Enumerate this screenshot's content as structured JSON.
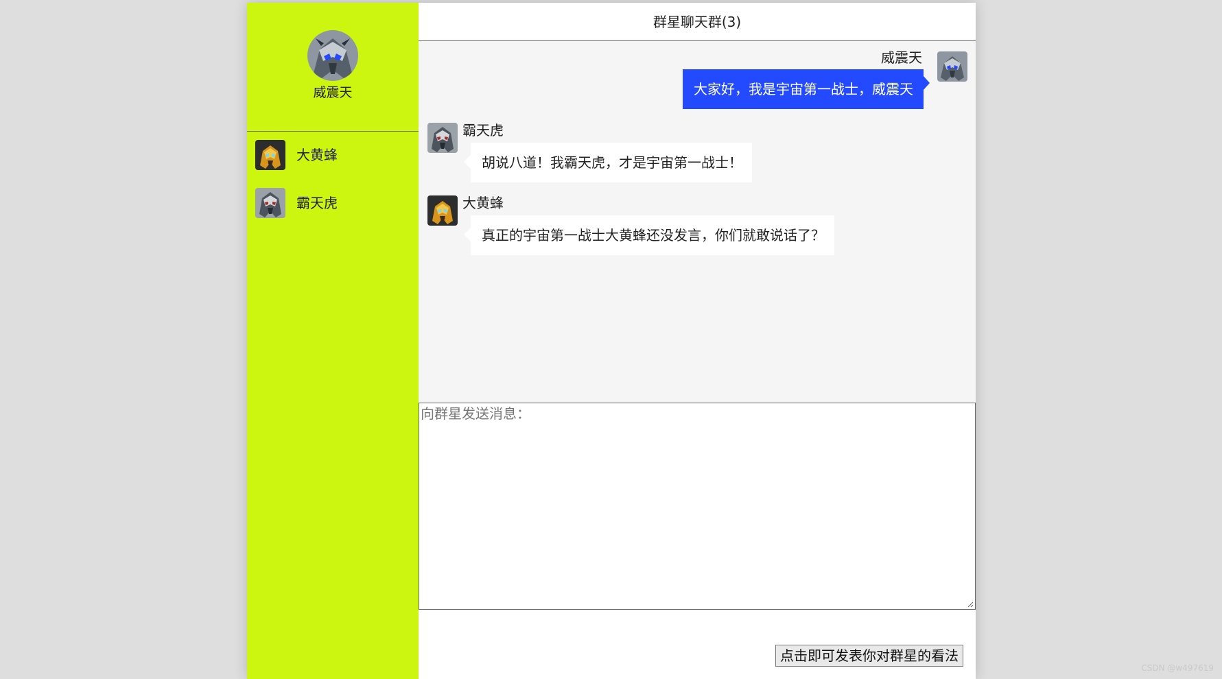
{
  "app": {
    "sidebar_color": "#ccf50f",
    "message_area_color": "#f5f5f5",
    "sent_bubble_color": "#244aff"
  },
  "current_user": {
    "name": "威震天",
    "avatar_icon": "robot-helmet-avatar"
  },
  "contacts": [
    {
      "name": "大黄蜂",
      "avatar_icon": "yellow-robot-avatar"
    },
    {
      "name": "霸天虎",
      "avatar_icon": "gray-robot-avatar"
    }
  ],
  "chat": {
    "title": "群星聊天群(3)",
    "messages": [
      {
        "sender": "威震天",
        "text": "大家好，我是宇宙第一战士，威震天",
        "alignment": "right"
      },
      {
        "sender": "霸天虎",
        "text": "胡说八道！我霸天虎，才是宇宙第一战士！",
        "alignment": "left"
      },
      {
        "sender": "大黄蜂",
        "text": "真正的宇宙第一战士大黄蜂还没发言，你们就敢说话了？",
        "alignment": "left"
      }
    ]
  },
  "composer": {
    "placeholder": "向群星发送消息：",
    "value": ""
  },
  "send_button": {
    "label": "点击即可发表你对群星的看法"
  },
  "watermark": "CSDN @w497619"
}
